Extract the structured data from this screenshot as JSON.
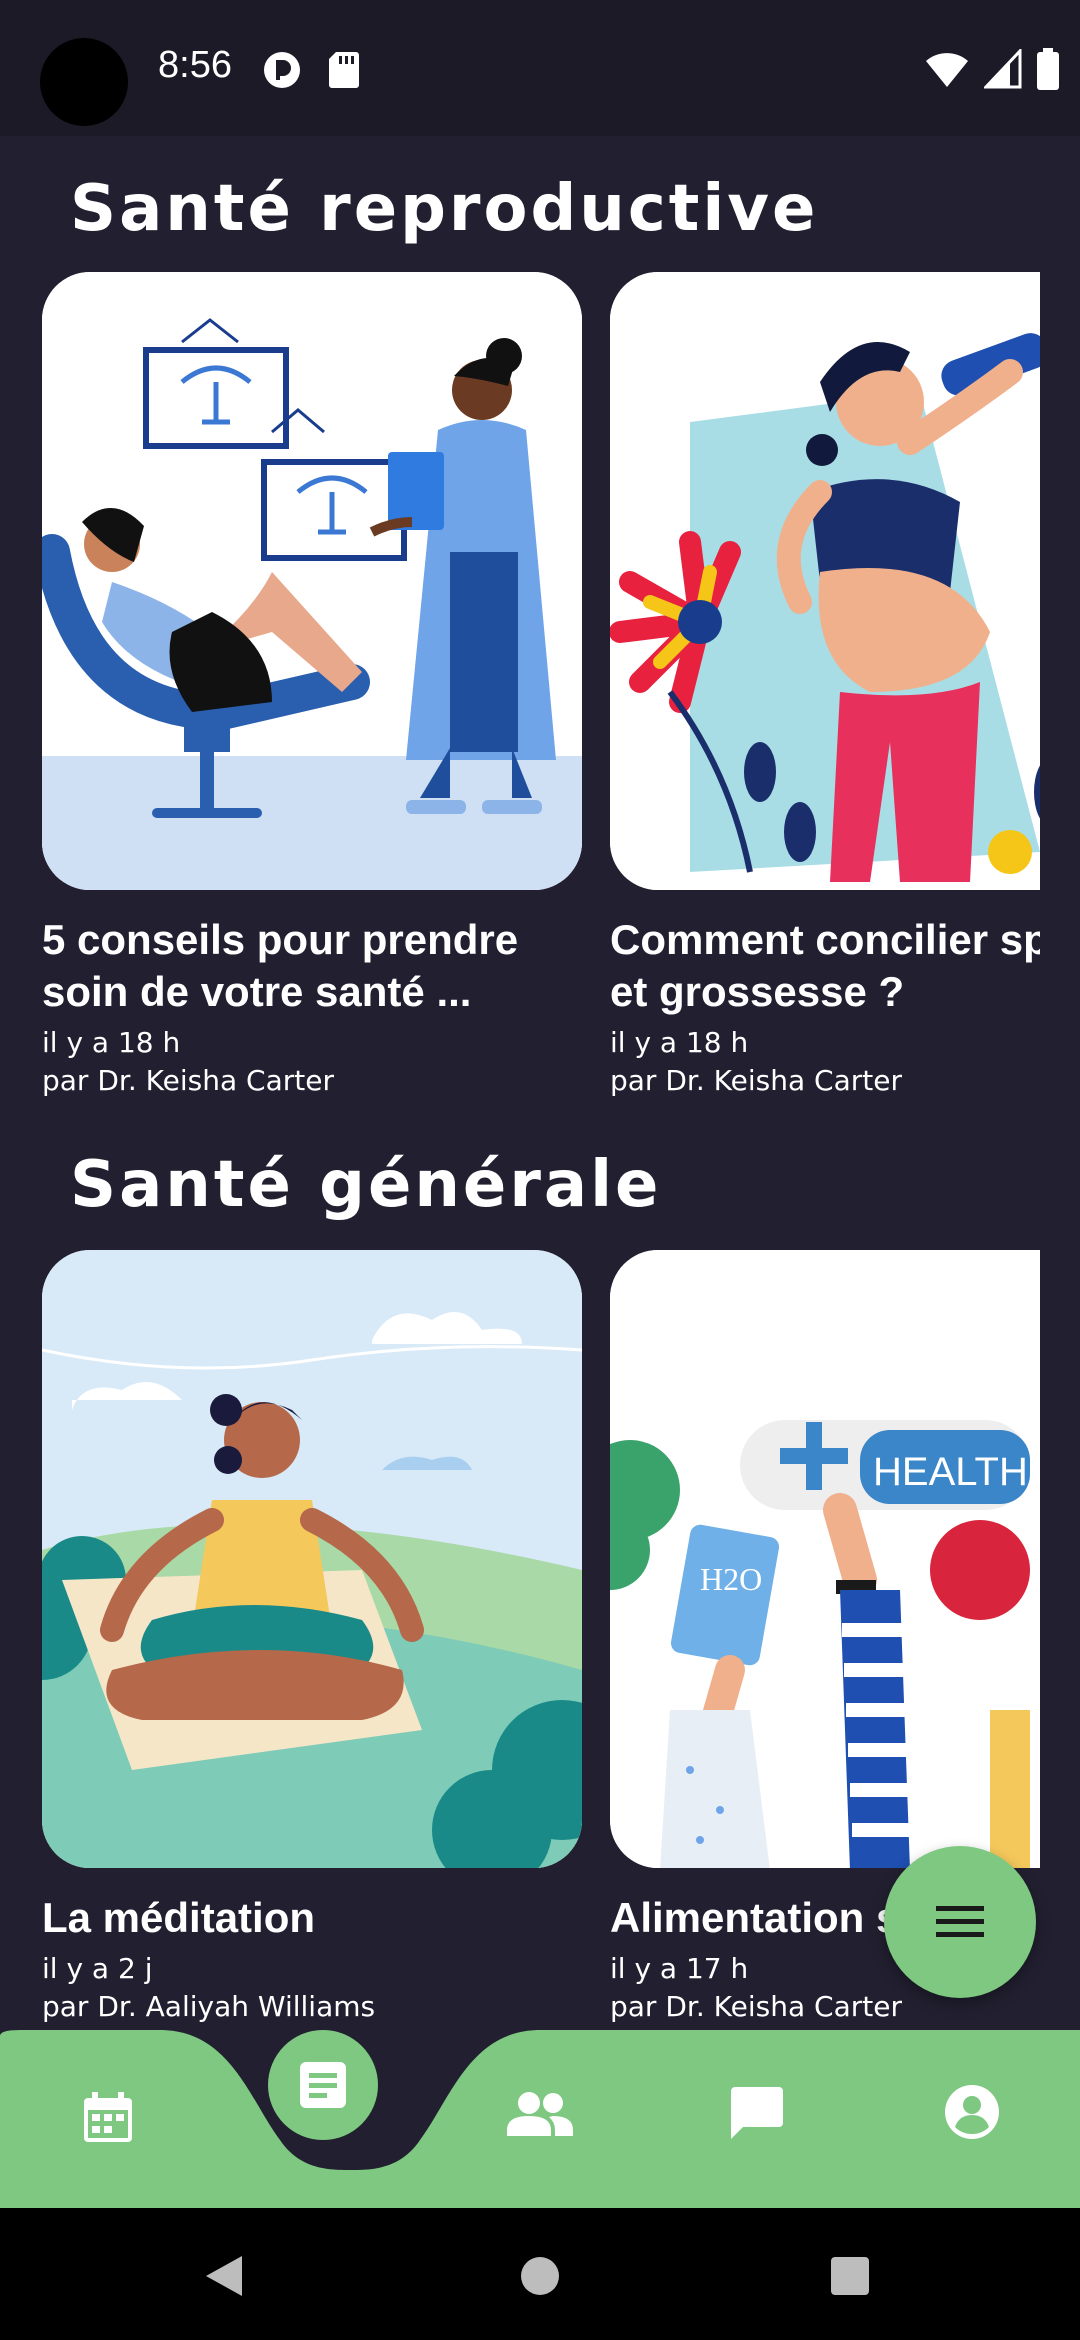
{
  "status_bar": {
    "time": "8:56",
    "icons_left": [
      "data-saver-icon",
      "sd-card-icon"
    ],
    "icons_right": [
      "wifi-icon",
      "signal-icon",
      "battery-icon"
    ]
  },
  "sections": [
    {
      "title": "Santé reproductive",
      "cards": [
        {
          "title_line1": "5 conseils pour prendre",
          "title_line2": "soin de votre santé ...",
          "time": "il y a 18 h",
          "author": "par Dr. Keisha Carter"
        },
        {
          "title_line1": "Comment concilier sp",
          "title_line2": "et grossesse ?",
          "time": "il y a 18 h",
          "author": "par Dr. Keisha Carter"
        }
      ]
    },
    {
      "title": "Santé générale",
      "cards": [
        {
          "title_line1": "La méditation",
          "time": "il y a 2 j",
          "author": "par Dr. Aaliyah Williams"
        },
        {
          "title_line1": "Alimentation s",
          "time": "il y a 17 h",
          "author": "par Dr. Keisha Carter",
          "image_badge": "HEALTH",
          "image_glass_label": "H2O"
        }
      ]
    }
  ],
  "fab": {
    "icon": "menu-icon"
  },
  "bottom_nav": {
    "items": [
      "calendar-icon",
      "article-icon",
      "group-icon",
      "chat-icon",
      "account-icon"
    ],
    "active": "article-icon"
  },
  "colors": {
    "background": "#222030",
    "accent": "#7ec882",
    "status_bar": "#1c1a26"
  }
}
